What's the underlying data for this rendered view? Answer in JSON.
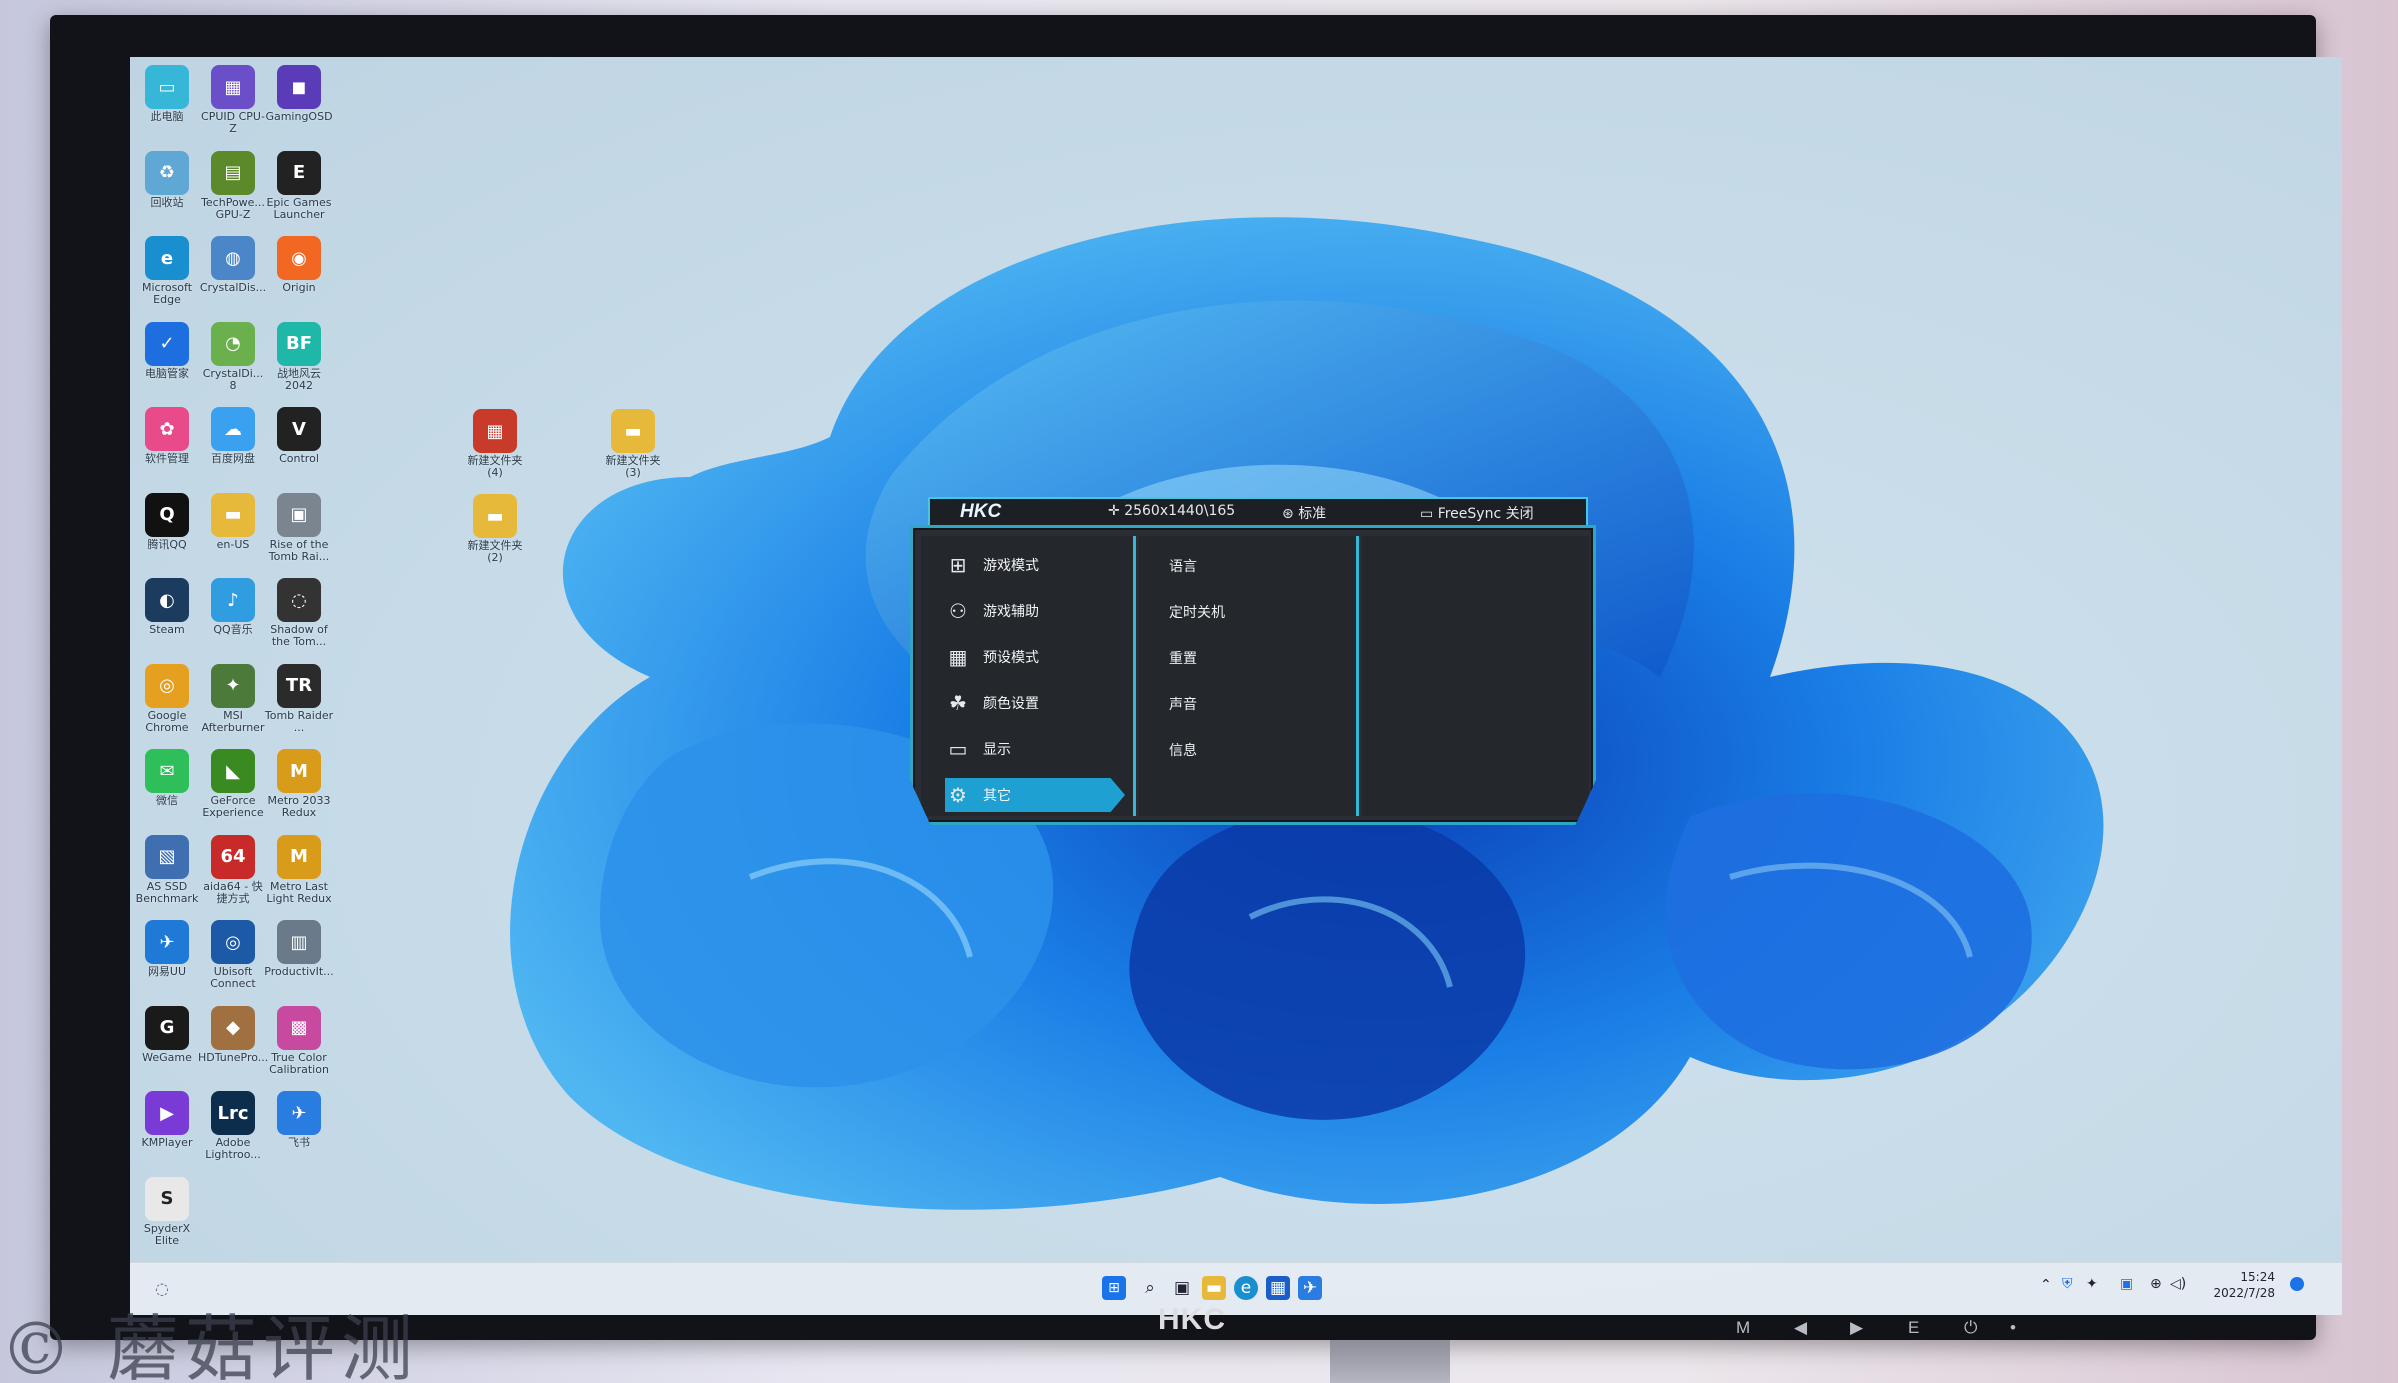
{
  "desktop_icons": [
    {
      "label": "此电脑",
      "color": "#37b7d7",
      "glyph": "▭"
    },
    {
      "label": "CPUID CPU-Z",
      "color": "#6b4fc8",
      "glyph": "▦"
    },
    {
      "label": "GamingOSD",
      "color": "#5a3cb8",
      "glyph": "◼"
    },
    {
      "label": "回收站",
      "color": "#5fa7d4",
      "glyph": "♻"
    },
    {
      "label": "TechPowe... GPU-Z",
      "color": "#5c8a2a",
      "glyph": "▤"
    },
    {
      "label": "Epic Games Launcher",
      "color": "#222222",
      "glyph": "E"
    },
    {
      "label": "Microsoft Edge",
      "color": "#1a8fcf",
      "glyph": "e"
    },
    {
      "label": "CrystalDis...",
      "color": "#4a86c8",
      "glyph": "◍"
    },
    {
      "label": "Origin",
      "color": "#f26722",
      "glyph": "◉"
    },
    {
      "label": "电脑管家",
      "color": "#1d6fe0",
      "glyph": "✓"
    },
    {
      "label": "CrystalDi... 8",
      "color": "#6ab04c",
      "glyph": "◔"
    },
    {
      "label": "战地风云 2042",
      "color": "#1fb8a8",
      "glyph": "BF"
    },
    {
      "label": "软件管理",
      "color": "#e94b8a",
      "glyph": "✿"
    },
    {
      "label": "百度网盘",
      "color": "#3aa0f0",
      "glyph": "☁"
    },
    {
      "label": "Control",
      "color": "#222222",
      "glyph": "V"
    },
    {
      "label": "腾讯QQ",
      "color": "#111111",
      "glyph": "Q"
    },
    {
      "label": "en-US",
      "color": "#e6b93a",
      "glyph": "▬"
    },
    {
      "label": "Rise of the Tomb Rai...",
      "color": "#7b8590",
      "glyph": "▣"
    },
    {
      "label": "Steam",
      "color": "#1b3b5f",
      "glyph": "◐"
    },
    {
      "label": "QQ音乐",
      "color": "#2f9de0",
      "glyph": "♪"
    },
    {
      "label": "Shadow of the Tom...",
      "color": "#333333",
      "glyph": "◌"
    },
    {
      "label": "Google Chrome",
      "color": "#e6a020",
      "glyph": "◎"
    },
    {
      "label": "MSI Afterburner",
      "color": "#4c7a3a",
      "glyph": "✦"
    },
    {
      "label": "Tomb Raider ...",
      "color": "#2b2b2b",
      "glyph": "TR"
    },
    {
      "label": "微信",
      "color": "#2fbf5a",
      "glyph": "✉"
    },
    {
      "label": "GeForce Experience",
      "color": "#3a8a22",
      "glyph": "◣"
    },
    {
      "label": "Metro 2033 Redux",
      "color": "#d89c1a",
      "glyph": "M"
    },
    {
      "label": "AS SSD Benchmark",
      "color": "#3f6fb0",
      "glyph": "▧"
    },
    {
      "label": "aida64 - 快捷方式",
      "color": "#c82a2a",
      "glyph": "64"
    },
    {
      "label": "Metro Last Light Redux",
      "color": "#d89c1a",
      "glyph": "M"
    },
    {
      "label": "网易UU",
      "color": "#1e7ad6",
      "glyph": "✈"
    },
    {
      "label": "Ubisoft Connect",
      "color": "#1c5aa8",
      "glyph": "◎"
    },
    {
      "label": "ProductivIt...",
      "color": "#6a7a8a",
      "glyph": "▥"
    },
    {
      "label": "WeGame",
      "color": "#1a1a1a",
      "glyph": "G"
    },
    {
      "label": "HDTunePro...",
      "color": "#a07040",
      "glyph": "◆"
    },
    {
      "label": "True Color Calibration",
      "color": "#c84aa0",
      "glyph": "▩"
    },
    {
      "label": "KMPlayer",
      "color": "#7a3ad6",
      "glyph": "▶"
    },
    {
      "label": "Adobe Lightroo...",
      "color": "#0d2d4d",
      "glyph": "Lrc"
    },
    {
      "label": "飞书",
      "color": "#2a7de0",
      "glyph": "✈"
    },
    {
      "label": "SpyderX Elite",
      "color": "#e8e8e8",
      "glyph": "S"
    }
  ],
  "extra_icons": [
    {
      "label": "新建文件夹 (4)",
      "color": "#c83a2a",
      "glyph": "▦"
    },
    {
      "label": "新建文件夹 (3)",
      "color": "#e6b93a",
      "glyph": "▬"
    },
    {
      "label": "新建文件夹 (2)",
      "color": "#e6b93a",
      "glyph": "▬"
    }
  ],
  "osd": {
    "logo": "HKC",
    "resolution": "2560x1440\\165",
    "mode": "标准",
    "freesync": "FreeSync 关闭",
    "menu": [
      {
        "label": "游戏模式",
        "icon": "game-mode-icon",
        "glyph": "⊞"
      },
      {
        "label": "游戏辅助",
        "icon": "gamepad-icon",
        "glyph": "⚇"
      },
      {
        "label": "预设模式",
        "icon": "grid-icon",
        "glyph": "▦"
      },
      {
        "label": "颜色设置",
        "icon": "color-icon",
        "glyph": "☘"
      },
      {
        "label": "显示",
        "icon": "monitor-icon",
        "glyph": "▭"
      },
      {
        "label": "其它",
        "icon": "gear-icon",
        "glyph": "⚙",
        "selected": true
      }
    ],
    "submenu": [
      "语言",
      "定时关机",
      "重置",
      "声音",
      "信息"
    ]
  },
  "taskbar": {
    "time": "15:24",
    "date": "2022/7/28"
  },
  "monitor": {
    "brand": "HKC",
    "buttons": [
      "M",
      "◀",
      "▶",
      "E",
      "⏻",
      "•"
    ]
  },
  "watermark": "© 蘑菇评测"
}
